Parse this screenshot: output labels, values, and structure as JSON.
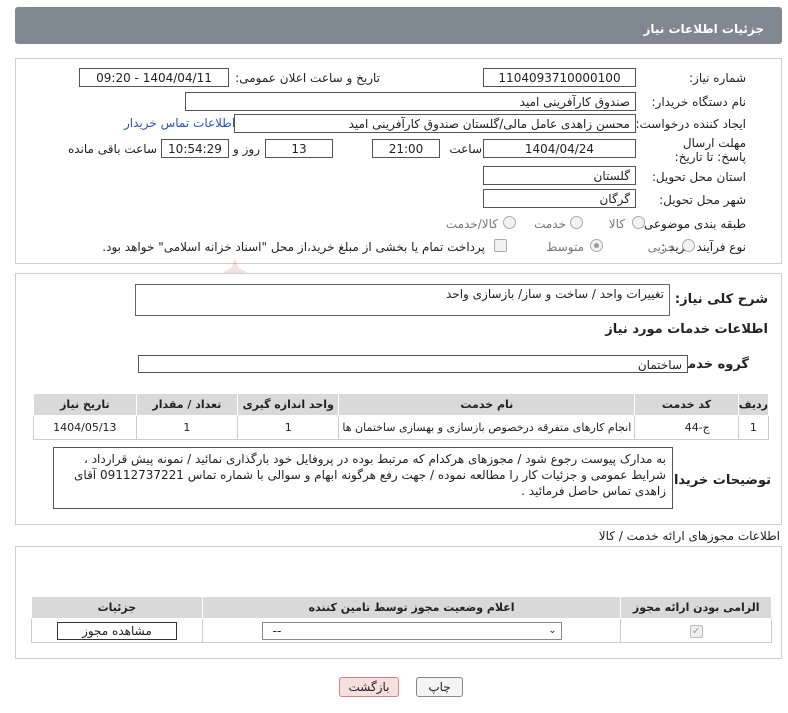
{
  "header": {
    "title": "جزئیات اطلاعات نیاز"
  },
  "form": {
    "need_no_label": "شماره نیاز:",
    "need_no": "1104093710000100",
    "announce_label": "تاریخ و ساعت اعلان عمومی:",
    "announce": "1404/04/11 - 09:20",
    "buyer_org_label": "نام دستگاه خریدار:",
    "buyer_org": "صندوق کارآفرینی امید",
    "creator_label": "ایجاد کننده درخواست:",
    "creator": "محسن زاهدی عامل مالی/گلستان صندوق کارآفرینی امید",
    "contact_link": "اطلاعات تماس خریدار",
    "deadline_label": "مهلت ارسال پاسخ: تا تاریخ:",
    "deadline_date": "1404/04/24",
    "time_label": "ساعت",
    "deadline_time": "21:00",
    "days": "13",
    "days_label": "روز و",
    "remaining": "10:54:29",
    "remaining_label": "ساعت باقی مانده",
    "province_label": "استان محل تحویل:",
    "province": "گلستان",
    "city_label": "شهر محل تحویل:",
    "city": "گرگان",
    "category_label": "طبقه بندی موضوعی:",
    "category_options": [
      "کالا",
      "خدمت",
      "کالا/خدمت"
    ],
    "process_label": "نوع فرآیند خرید :",
    "process_options": [
      "جزیی",
      "متوسط"
    ],
    "payment_note": "پرداخت تمام یا بخشی از مبلغ خرید،از محل \"اسناد خزانه اسلامی\" خواهد بود."
  },
  "details": {
    "summary_label": "شرح کلی نیاز:",
    "summary": "تغییرات واحد / ساخت و ساز/ بازسازی واحد",
    "services_title": "اطلاعات خدمات مورد نیاز",
    "group_label": "گروه خدمت:",
    "group": "ساختمان",
    "table": {
      "headers": [
        "ردیف",
        "کد خدمت",
        "نام خدمت",
        "واحد اندازه گیری",
        "تعداد / مقدار",
        "تاریخ نیاز"
      ],
      "rows": [
        [
          "1",
          "ج-44",
          "انجام کارهای متفرقه درخصوص بازسازی و بهسازی ساختمان ها",
          "1",
          "1",
          "1404/05/13"
        ]
      ]
    },
    "buyer_notes_label": "توضیحات خریدار:",
    "buyer_notes": "به مدارک پیوست رجوع شود / مجوزهای هرکدام که مرتبط بوده در پروفایل خود بارگذاری نمائید / نمونه پیش قرارداد ، شرایط عمومی و جزئیات کار را مطالعه نموده / جهت رفع هرگونه ابهام و سوالی با شماره تماس 09112737221 آقای زاهدی تماس حاصل فرمائید ."
  },
  "permits": {
    "title": "اطلاعات مجوزهای ارائه خدمت / کالا",
    "headers": [
      "الزامی بودن ارائه مجوز",
      "اعلام وضعیت مجوز توسط تامین کننده",
      "جزئیات"
    ],
    "select_value": "--",
    "view_button": "مشاهده مجوز"
  },
  "footer": {
    "print": "چاپ",
    "back": "بازگشت"
  },
  "watermark": {
    "text": "AriaTender.neT"
  },
  "colors": {
    "header_bg": "#7f8890",
    "table_header": "#d9d9d9",
    "link": "#2a55b8",
    "back_btn": "#f9dede",
    "print_btn": "#f4f4f4"
  }
}
